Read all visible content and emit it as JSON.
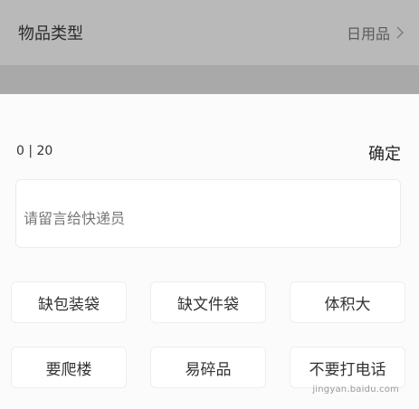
{
  "background": {
    "item_type_label": "物品类型",
    "item_type_value": "日用品"
  },
  "sheet": {
    "counter": "0 | 20",
    "confirm_label": "确定",
    "message_placeholder": "请留言给快递员",
    "message_value": "",
    "tags": [
      "缺包装袋",
      "缺文件袋",
      "体积大",
      "要爬楼",
      "易碎品",
      "不要打电话"
    ]
  },
  "watermark": "jingyan.baidu.com"
}
